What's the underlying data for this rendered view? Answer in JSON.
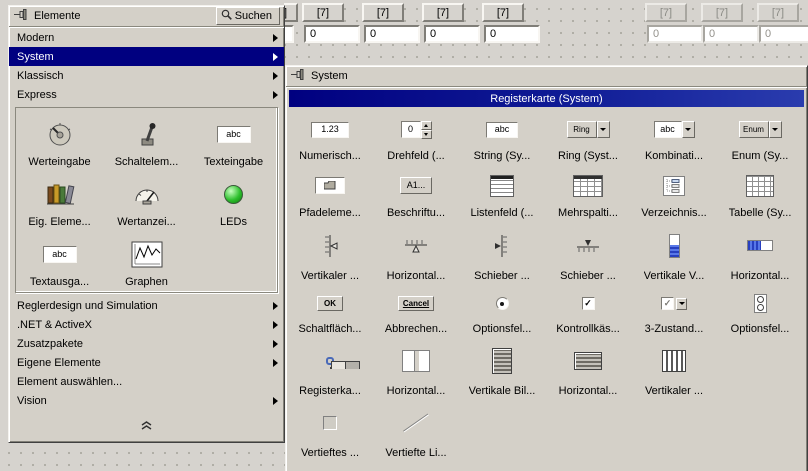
{
  "colors": {
    "selection_navy": "#000080",
    "palette_bg": "#d4d0c8",
    "selected_outline": "#4a6ab8",
    "led_green": "#2ec02e"
  },
  "background": {
    "clipped_index_text": "]",
    "arrays": [
      {
        "index": "[7]",
        "value": "0"
      },
      {
        "index": "[7]",
        "value": "0"
      },
      {
        "index": "[7]",
        "value": "0"
      },
      {
        "index": "[7]",
        "value": "0"
      },
      {
        "index": "[7]",
        "value": "0"
      },
      {
        "index": "[7]",
        "value": "0"
      },
      {
        "index": "[7]",
        "value": "0"
      }
    ]
  },
  "elements_palette": {
    "title": "Elemente",
    "search_label": "Suchen",
    "categories_top": [
      {
        "label": "Modern",
        "selected": false
      },
      {
        "label": "System",
        "selected": true
      },
      {
        "label": "Klassisch",
        "selected": false
      },
      {
        "label": "Express",
        "selected": false
      }
    ],
    "grid": [
      {
        "label": "Werteingabe"
      },
      {
        "label": "Schaltelem..."
      },
      {
        "label": "Texteingabe"
      },
      {
        "label": "Eig. Eleme..."
      },
      {
        "label": "Wertanzei..."
      },
      {
        "label": "LEDs"
      },
      {
        "label": "Textausga..."
      },
      {
        "label": "Graphen"
      }
    ],
    "categories_bottom": [
      {
        "label": "Reglerdesign und Simulation"
      },
      {
        "label": ".NET & ActiveX"
      },
      {
        "label": "Zusatzpakete"
      },
      {
        "label": "Eigene Elemente"
      },
      {
        "label": "Element auswählen..."
      },
      {
        "label": "Vision"
      }
    ],
    "icon_texts": {
      "abc": "abc"
    }
  },
  "system_palette": {
    "title": "System",
    "header": "Registerkarte (System)",
    "items": [
      "Numerisch...",
      "Drehfeld (...",
      "String (Sy...",
      "Ring (Syst...",
      "Kombinati...",
      "Enum (Sy...",
      "Pfadeleme...",
      "Beschriftu...",
      "Listenfeld (...",
      "Mehrspalti...",
      "Verzeichnis...",
      "Tabelle (Sy...",
      "Vertikaler ...",
      "Horizontal...",
      "Schieber ...",
      "Schieber ...",
      "Vertikale V...",
      "Horizontal...",
      "Schaltfläch...",
      "Abbrechen...",
      "Optionsfel...",
      "Kontrollkäs...",
      "3-Zustand...",
      "Optionsfel...",
      "Registerka...",
      "Horizontal...",
      "Vertikale Bil...",
      "Horizontal...",
      "Vertikaler ...",
      "Vertieftes ...",
      "Vertiefte Li..."
    ],
    "icon_texts": {
      "numeric": "1.23",
      "spin": "0",
      "string": "abc",
      "ring": "Ring",
      "combo": "abc",
      "enum": "Enum",
      "caption": "A1...",
      "ok": "OK",
      "cancel": "Cancel"
    }
  }
}
